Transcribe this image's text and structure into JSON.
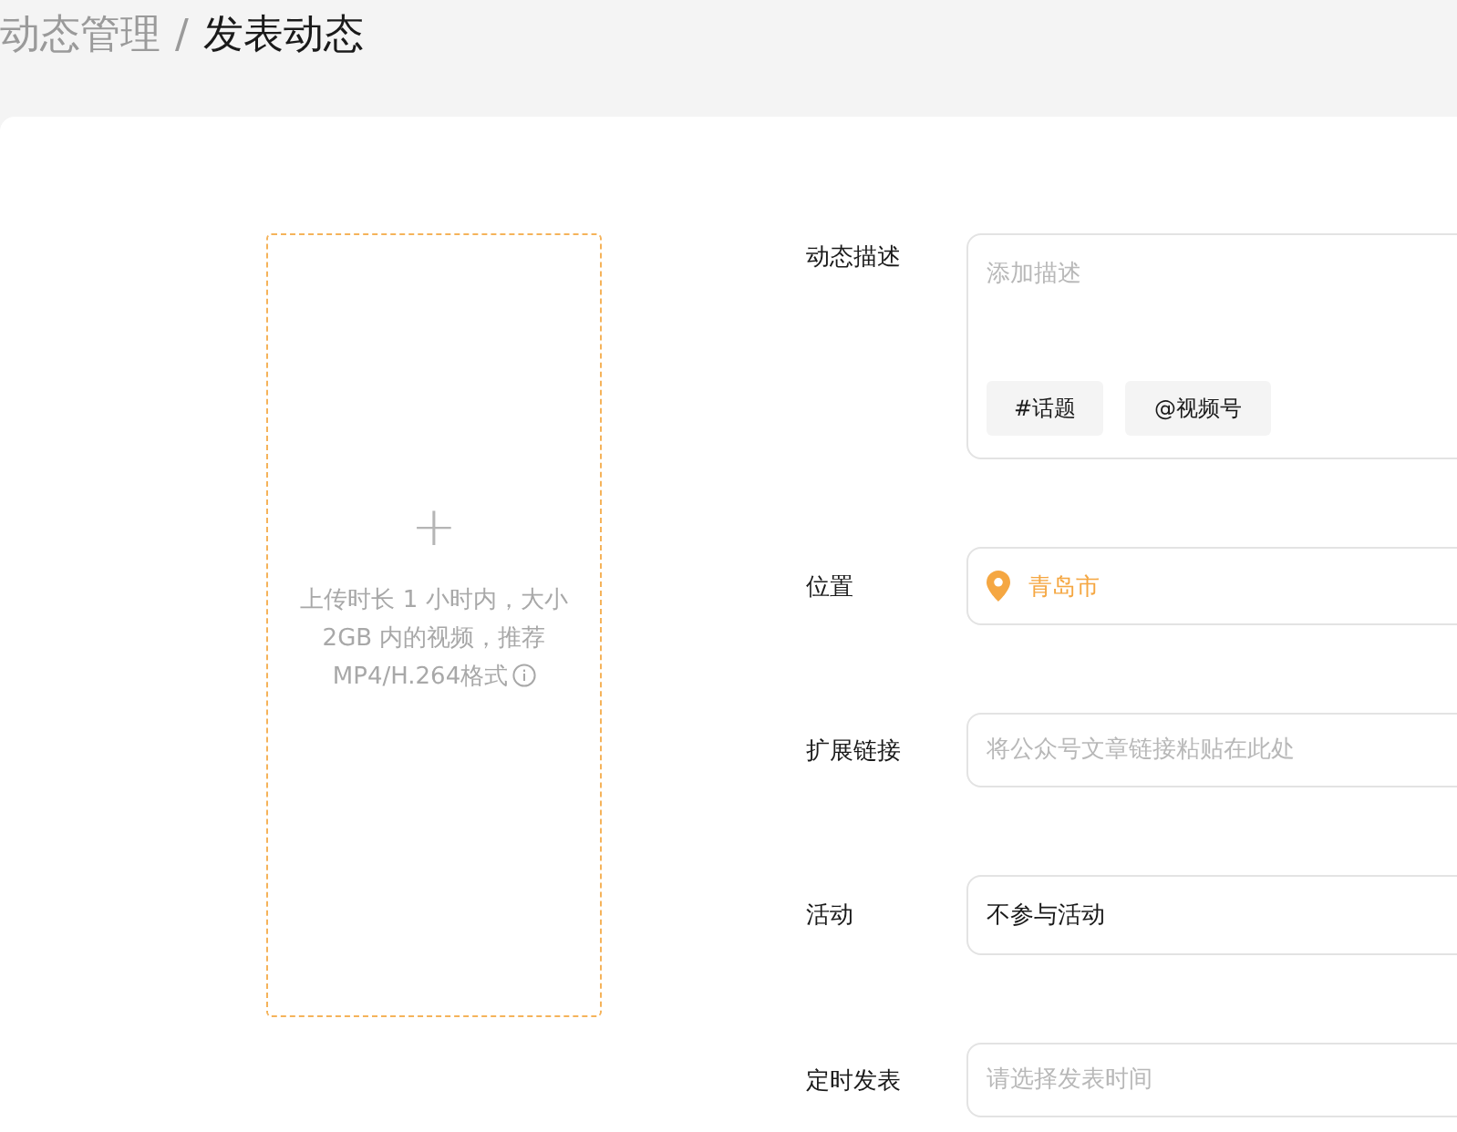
{
  "breadcrumb": [
    {
      "label": "动态管理",
      "selected": false
    },
    {
      "label": "发表动态",
      "selected": true
    }
  ],
  "breadcrumb_separator": "/",
  "upload": {
    "icon": "+",
    "hint": "上传时长 1 小时内，大小 2GB 内的视频，推荐MP4/H.264格式"
  },
  "fields": [
    {
      "kind": "description",
      "label": "动态描述",
      "placeholder": "添加描述",
      "tags": [
        "#话题",
        "@视频号"
      ]
    },
    {
      "kind": "location",
      "label": "位置",
      "value": "青岛市"
    },
    {
      "kind": "input",
      "label": "扩展链接",
      "placeholder": "将公众号文章链接粘贴在此处"
    },
    {
      "kind": "select",
      "label": "活动",
      "value": "不参与活动"
    },
    {
      "kind": "input",
      "label": "定时发表",
      "placeholder": "请选择发表时间"
    }
  ]
}
